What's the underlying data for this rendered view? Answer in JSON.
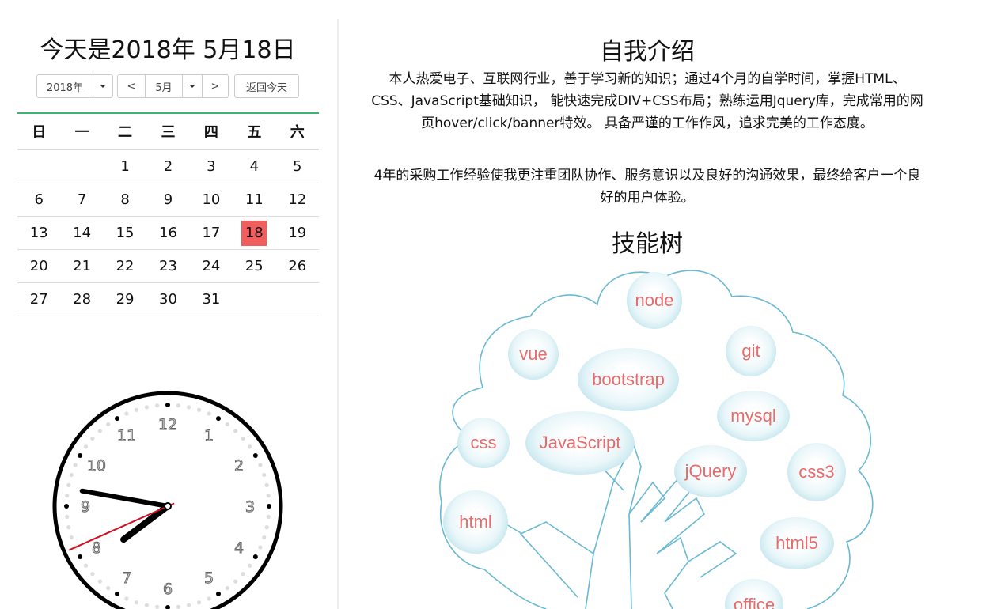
{
  "calendar": {
    "title": "今天是2018年 5月18日",
    "year_select": "2018年",
    "prev": "<",
    "month_select": "5月",
    "next": ">",
    "today_button": "返回今天",
    "weekdays": [
      "日",
      "一",
      "二",
      "三",
      "四",
      "五",
      "六"
    ],
    "weeks": [
      [
        "",
        "",
        "1",
        "2",
        "3",
        "4",
        "5"
      ],
      [
        "6",
        "7",
        "8",
        "9",
        "10",
        "11",
        "12"
      ],
      [
        "13",
        "14",
        "15",
        "16",
        "17",
        "18",
        "19"
      ],
      [
        "20",
        "21",
        "22",
        "23",
        "24",
        "25",
        "26"
      ],
      [
        "27",
        "28",
        "29",
        "30",
        "31",
        "",
        ""
      ]
    ],
    "today": "18"
  },
  "clock": {
    "numbers": [
      "12",
      "1",
      "2",
      "3",
      "4",
      "5",
      "6",
      "7",
      "8",
      "9",
      "10",
      "11"
    ],
    "hour": 7,
    "minute": 46,
    "second": 41
  },
  "intro": {
    "title": "自我介绍",
    "p1": "本人热爱电子、互联网行业，善于学习新的知识；通过4个月的自学时间，掌握HTML、CSS、JavaScript基础知识， 能快速完成DIV+CSS布局；熟练运用Jquery库，完成常用的网页hover/click/banner特效。 具备严谨的工作作风，追求完美的工作态度。",
    "p2": "4年的采购工作经验使我更注重团队协作、服务意识以及良好的沟通效果，最终给客户一个良好的用户体验。"
  },
  "skills": {
    "title": "技能树",
    "items": {
      "node": "node",
      "vue": "vue",
      "git": "git",
      "bootstrap": "bootstrap",
      "mysql": "mysql",
      "css": "css",
      "javascript": "JavaScript",
      "jquery": "jQuery",
      "css3": "css3",
      "html": "html",
      "html5": "html5",
      "office": "office"
    }
  },
  "colors": {
    "today_highlight": "#f25e5e",
    "tree_stroke": "#6ab9d2",
    "skill_text": "#e86a6a",
    "table_accent": "#3cb371"
  }
}
